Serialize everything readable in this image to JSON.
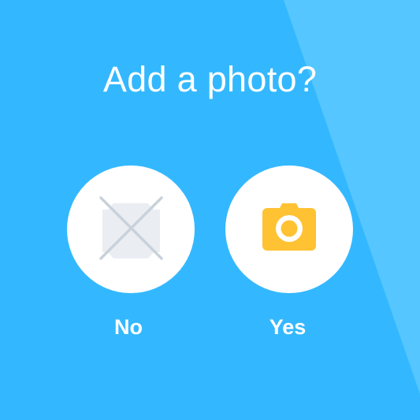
{
  "prompt": {
    "title": "Add a photo?"
  },
  "options": {
    "no": {
      "label": "No",
      "icon": "no-photo-icon"
    },
    "yes": {
      "label": "Yes",
      "icon": "camera-icon"
    }
  },
  "colors": {
    "background": "#33b8ff",
    "stripe": "#55c6ff",
    "circle": "#ffffff",
    "camera": "#ffc233",
    "no_icon_fill": "#eaeef3",
    "no_icon_cross": "#c9d1da",
    "text": "#ffffff"
  }
}
